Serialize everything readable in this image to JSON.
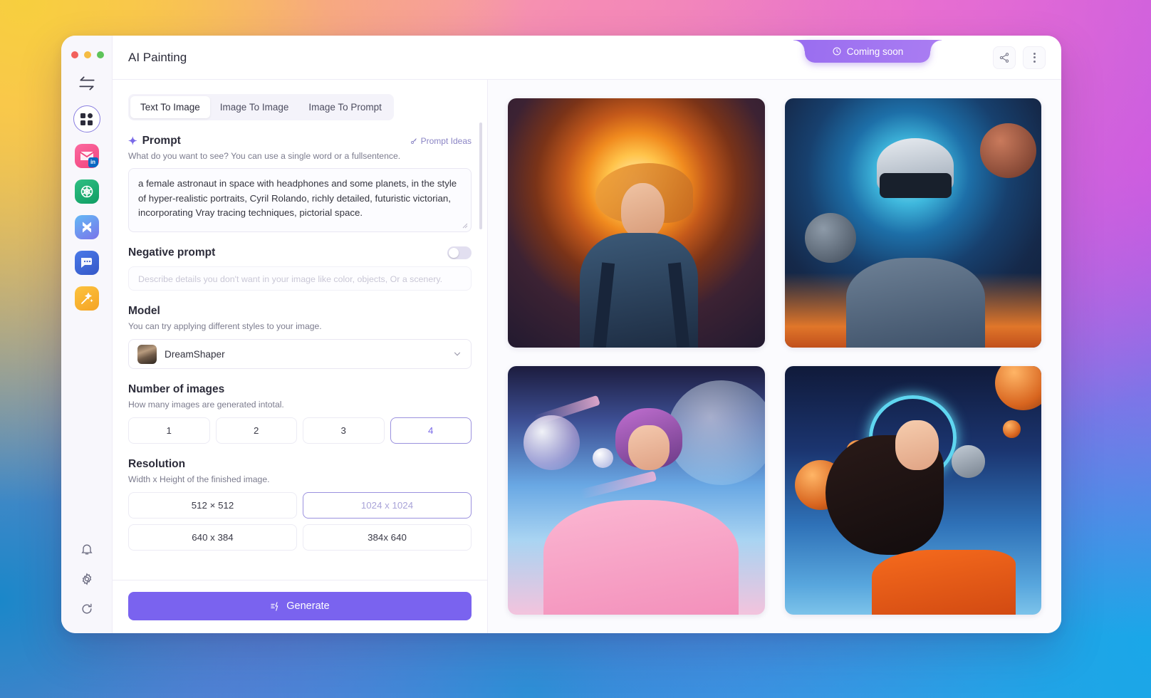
{
  "window": {
    "title": "AI Painting",
    "traffic_lights": [
      "close",
      "minimize",
      "maximize"
    ]
  },
  "badge": {
    "label": "Coming soon",
    "icon": "clock-icon",
    "color": "#9a6ef0"
  },
  "topbar": {
    "share_icon": "share-icon",
    "more_icon": "more-vertical-icon"
  },
  "rail": {
    "swap_icon": "swap-arrows-icon",
    "apps": [
      {
        "name": "apps-grid",
        "label": "Apps"
      },
      {
        "name": "mail-linkedin",
        "label": "Mail"
      },
      {
        "name": "openai",
        "label": "ChatGPT"
      },
      {
        "name": "flow",
        "label": "Flow"
      },
      {
        "name": "chat",
        "label": "Chat"
      },
      {
        "name": "magic-wand",
        "label": "Magic"
      }
    ],
    "bottom": [
      {
        "name": "bell-icon",
        "label": "Notifications"
      },
      {
        "name": "gear-icon",
        "label": "Settings"
      },
      {
        "name": "refresh-icon",
        "label": "Refresh"
      }
    ]
  },
  "tabs": [
    {
      "label": "Text To Image",
      "active": true
    },
    {
      "label": "Image To Image",
      "active": false
    },
    {
      "label": "Image To Prompt",
      "active": false
    }
  ],
  "prompt": {
    "title": "Prompt",
    "ideas_label": "Prompt Ideas",
    "ideas_icon": "key-icon",
    "sparkle_icon": "sparkle-icon",
    "description": "What do you want to see? You can use a single word or a fullsentence.",
    "value": "a female astronaut in space with headphones and some planets, in the style of hyper-realistic portraits, Cyril Rolando, richly detailed, futuristic victorian, incorporating Vray tracing techniques, pictorial space."
  },
  "negative_prompt": {
    "title": "Negative prompt",
    "toggle_on": false,
    "placeholder": "Describe details you don't want in your image like color, objects, Or a scenery.",
    "value": ""
  },
  "model": {
    "title": "Model",
    "description": "You can try applying different styles to your image.",
    "selected": "DreamShaper",
    "chevron_icon": "chevron-down-icon"
  },
  "number_of_images": {
    "title": "Number of images",
    "description": "How many images are generated intotal.",
    "options": [
      "1",
      "2",
      "3",
      "4"
    ],
    "selected": "4"
  },
  "resolution": {
    "title": "Resolution",
    "description": "Width x Height of the finished image.",
    "options": [
      "512 × 512",
      "1024 x 1024",
      "640 x 384",
      "384x 640"
    ],
    "selected": "1024 x 1024"
  },
  "generate": {
    "label": "Generate",
    "icon": "lightning-icon",
    "color": "#7a63ef"
  },
  "results": [
    {
      "name": "result-1",
      "alt": "female astronaut before a glowing orange sun"
    },
    {
      "name": "result-2",
      "alt": "astronaut in helmet and goggles with cyan planet"
    },
    {
      "name": "result-3",
      "alt": "woman in pink dress with purple hair and bubbles"
    },
    {
      "name": "result-4",
      "alt": "woman in orange suit with headphones and planets"
    }
  ]
}
